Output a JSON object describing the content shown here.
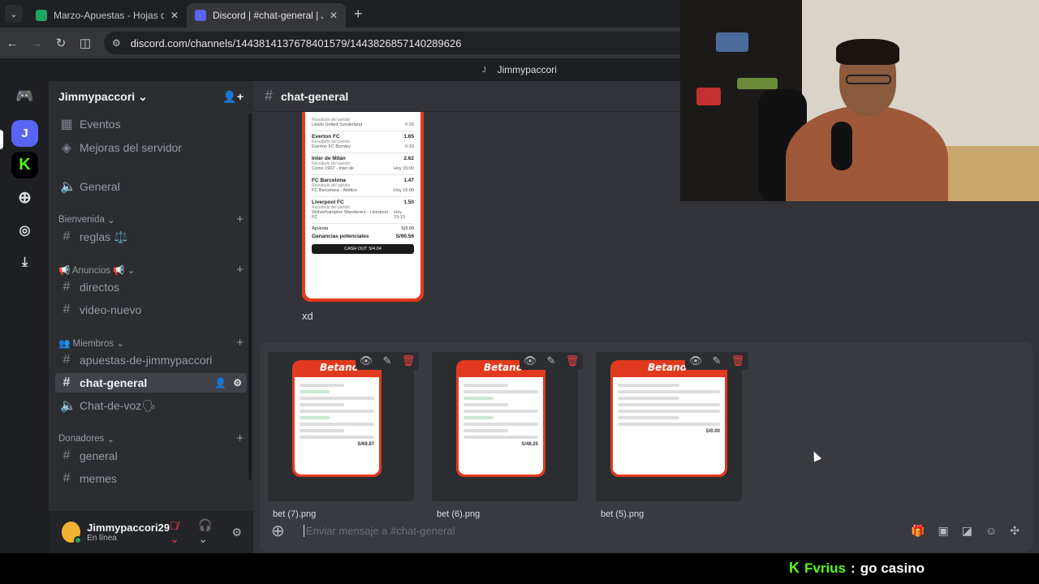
{
  "browser": {
    "tabs": [
      {
        "title": "Marzo-Apuestas - Hojas de cálc",
        "active": false,
        "favicon": "sheets-icon"
      },
      {
        "title": "Discord | #chat-general | Jimmy",
        "active": true,
        "favicon": "discord-icon"
      }
    ],
    "url": "discord.com/channels/1443814137678401579/1443826857140289626"
  },
  "discord": {
    "titlebar_user": "Jimmypaccori",
    "titlebar_initial": "J",
    "guild_j": "J",
    "server_name": "Jimmypaccori",
    "channels": {
      "eventos": "Eventos",
      "mejoras": "Mejoras del servidor",
      "general_voice": "General",
      "cat_bienvenida": "Bienvenida",
      "reglas": "reglas ⚖️",
      "cat_anuncios": "📢 Anuncios 📢",
      "directos": "directos",
      "video_nuevo": "video-nuevo",
      "cat_miembros": "👥 Miembros",
      "apuestas": "apuestas-de-jimmypaccori",
      "chat_general": "chat-general",
      "chat_de_voz": "Chat-de-voz🗣",
      "cat_donadores": "Donadores",
      "general": "general",
      "memes": "memes"
    },
    "user": {
      "name": "Jimmypaccori29",
      "status": "En línea"
    },
    "channel_header": "chat-general",
    "message": {
      "text": "xd",
      "slip": {
        "rows": [
          {
            "team": "",
            "odd": "",
            "sub": "Resultado del partido",
            "match": "Leeds United Sunderland",
            "right": "0:29"
          },
          {
            "team": "Everton FC",
            "odd": "1.65",
            "sub": "Resultado del partido",
            "match": "Everton FC Burnley",
            "right": "0:19"
          },
          {
            "team": "Inter de Milán",
            "odd": "2.62",
            "sub": "Resultado del partido",
            "match": "Como 1907 - Inter de",
            "right": "Hoy 15:00"
          },
          {
            "team": "FC Barcelona",
            "odd": "1.47",
            "sub": "Resultado del partido",
            "match": "FC Barcelona - Atlético",
            "right": "Hoy 15:00"
          },
          {
            "team": "Liverpool FC",
            "odd": "1.50",
            "sub": "Resultado del partido",
            "match": "Wolverhampton Wanderers - Liverpool FC",
            "right": "Hoy 15:15"
          }
        ],
        "apuesta_label": "Apuesta",
        "apuesta_value": "S/3.00",
        "ganancias_label": "Ganancias potenciales",
        "ganancias_value": "S/90.56",
        "cashout": "CASH OUT  S/4.04"
      }
    },
    "attachments": [
      {
        "filename": "bet (7).png",
        "brand": "Betano",
        "total": "S/69.87"
      },
      {
        "filename": "bet (6).png",
        "brand": "Betano",
        "total": "S/48.25"
      },
      {
        "filename": "bet (5).png",
        "brand": "Betano",
        "total": "S/0.00"
      }
    ],
    "composer_placeholder": "Enviar mensaje a #chat-general"
  },
  "stream_chat": {
    "user": "Fvrius",
    "separator": ":",
    "text": "go casino"
  },
  "colors": {
    "accent": "#5865f2",
    "kick": "#53fc18",
    "betano": "#e23a1e",
    "danger": "#f23f43"
  }
}
